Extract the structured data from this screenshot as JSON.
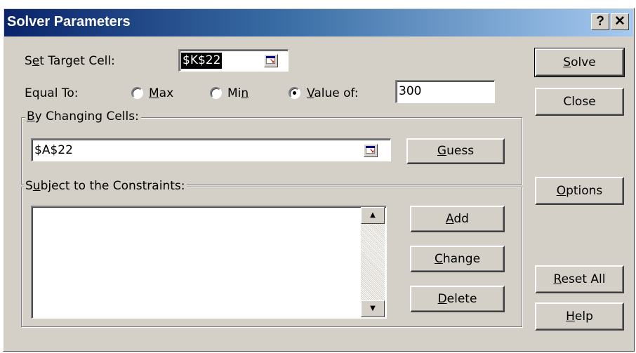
{
  "window": {
    "title": "Solver Parameters",
    "help_btn": "?",
    "close_btn": "✕"
  },
  "target": {
    "label_pre": "S",
    "label_mnem": "e",
    "label_post": "t Target Cell:",
    "value": "$K$22"
  },
  "equal_to": {
    "label": "Equal To:",
    "max": {
      "pre": "",
      "mnem": "M",
      "post": "ax",
      "selected": false
    },
    "min": {
      "pre": "Mi",
      "mnem": "n",
      "post": "",
      "selected": false
    },
    "value_of": {
      "pre": "",
      "mnem": "V",
      "post": "alue of:",
      "selected": true
    },
    "value": "300"
  },
  "changing": {
    "label_pre": "",
    "label_mnem": "B",
    "label_post": "y Changing Cells:",
    "value": "$A$22"
  },
  "constraints": {
    "label_pre": "S",
    "label_mnem": "u",
    "label_post": "bject to the Constraints:",
    "items": []
  },
  "buttons": {
    "solve": {
      "pre": "",
      "mnem": "S",
      "post": "olve"
    },
    "close": {
      "label": "Close"
    },
    "guess": {
      "pre": "",
      "mnem": "G",
      "post": "uess"
    },
    "options": {
      "pre": "",
      "mnem": "O",
      "post": "ptions"
    },
    "add": {
      "pre": "",
      "mnem": "A",
      "post": "dd"
    },
    "change": {
      "pre": "",
      "mnem": "C",
      "post": "hange"
    },
    "delete": {
      "pre": "",
      "mnem": "D",
      "post": "elete"
    },
    "reset": {
      "pre": "",
      "mnem": "R",
      "post": "eset All"
    },
    "help": {
      "pre": "",
      "mnem": "H",
      "post": "elp"
    }
  },
  "colors": {
    "face": "#d4d0c8",
    "title_start": "#0a246a",
    "title_end": "#a6caf0",
    "selection": "#000000"
  }
}
